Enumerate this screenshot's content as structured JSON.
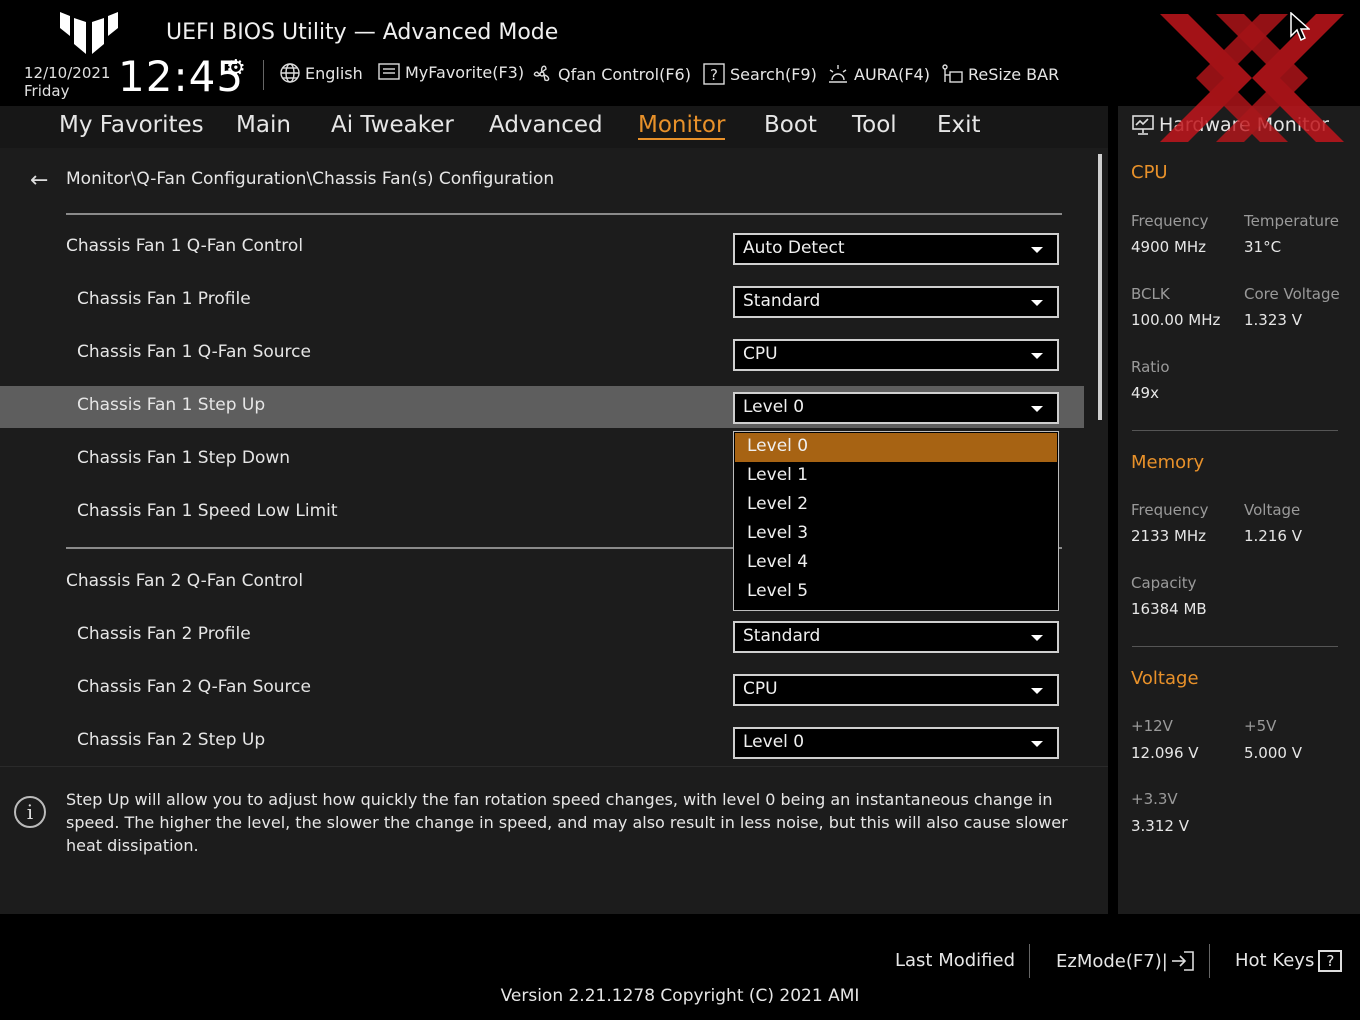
{
  "header": {
    "title": "UEFI BIOS Utility — Advanced Mode",
    "date": "12/10/2021",
    "day": "Friday",
    "time": "12:45",
    "toolbar": {
      "language": "English",
      "myfavorite": "MyFavorite(F3)",
      "qfan": "Qfan Control(F6)",
      "search": "Search(F9)",
      "aura": "AURA(F4)",
      "resize_bar": "ReSize BAR"
    }
  },
  "nav": {
    "items": [
      "My Favorites",
      "Main",
      "Ai Tweaker",
      "Advanced",
      "Monitor",
      "Boot",
      "Tool",
      "Exit"
    ],
    "active": "Monitor"
  },
  "breadcrumb": "Monitor\\Q-Fan Configuration\\Chassis Fan(s) Configuration",
  "settings": [
    {
      "label": "Chassis Fan 1 Q-Fan Control",
      "value": "Auto Detect"
    },
    {
      "label": "Chassis Fan 1 Profile",
      "value": "Standard"
    },
    {
      "label": "Chassis Fan 1 Q-Fan Source",
      "value": "CPU"
    },
    {
      "label": "Chassis Fan 1 Step Up",
      "value": "Level 0"
    },
    {
      "label": "Chassis Fan 1 Step Down",
      "value": ""
    },
    {
      "label": "Chassis Fan 1 Speed Low Limit",
      "value": ""
    },
    {
      "label": "Chassis Fan 2 Q-Fan Control",
      "value": ""
    },
    {
      "label": "Chassis Fan 2 Profile",
      "value": "Standard"
    },
    {
      "label": "Chassis Fan 2 Q-Fan Source",
      "value": "CPU"
    },
    {
      "label": "Chassis Fan 2 Step Up",
      "value": "Level 0"
    }
  ],
  "dropdown": {
    "options": [
      "Level 0",
      "Level 1",
      "Level 2",
      "Level 3",
      "Level 4",
      "Level 5"
    ],
    "selected": "Level 0"
  },
  "help": "Step Up will allow you to adjust how quickly the fan rotation speed changes, with level 0 being an instantaneous change in speed. The higher the level, the slower the change in speed, and may also result in less noise, but this will also cause slower heat dissipation.",
  "hardware_monitor": {
    "title": "Hardware Monitor",
    "cpu": {
      "heading": "CPU",
      "frequency_label": "Frequency",
      "frequency": "4900 MHz",
      "temperature_label": "Temperature",
      "temperature": "31°C",
      "bclk_label": "BCLK",
      "bclk": "100.00 MHz",
      "core_voltage_label": "Core Voltage",
      "core_voltage": "1.323 V",
      "ratio_label": "Ratio",
      "ratio": "49x"
    },
    "memory": {
      "heading": "Memory",
      "frequency_label": "Frequency",
      "frequency": "2133 MHz",
      "voltage_label": "Voltage",
      "voltage": "1.216 V",
      "capacity_label": "Capacity",
      "capacity": "16384 MB"
    },
    "voltage": {
      "heading": "Voltage",
      "v12_label": "+12V",
      "v12": "12.096 V",
      "v5_label": "+5V",
      "v5": "5.000 V",
      "v33_label": "+3.3V",
      "v33": "3.312 V"
    }
  },
  "footer": {
    "last_modified": "Last Modified",
    "ezmode": "EzMode(F7)|",
    "hotkeys": "Hot Keys",
    "hotkeys_icon": "?",
    "version": "Version 2.21.1278 Copyright (C) 2021 AMI"
  },
  "colors": {
    "accent": "#e8912a",
    "highlight_row": "#5e5e5e",
    "selected_option": "#a76313",
    "watermark": "#c0161c"
  }
}
